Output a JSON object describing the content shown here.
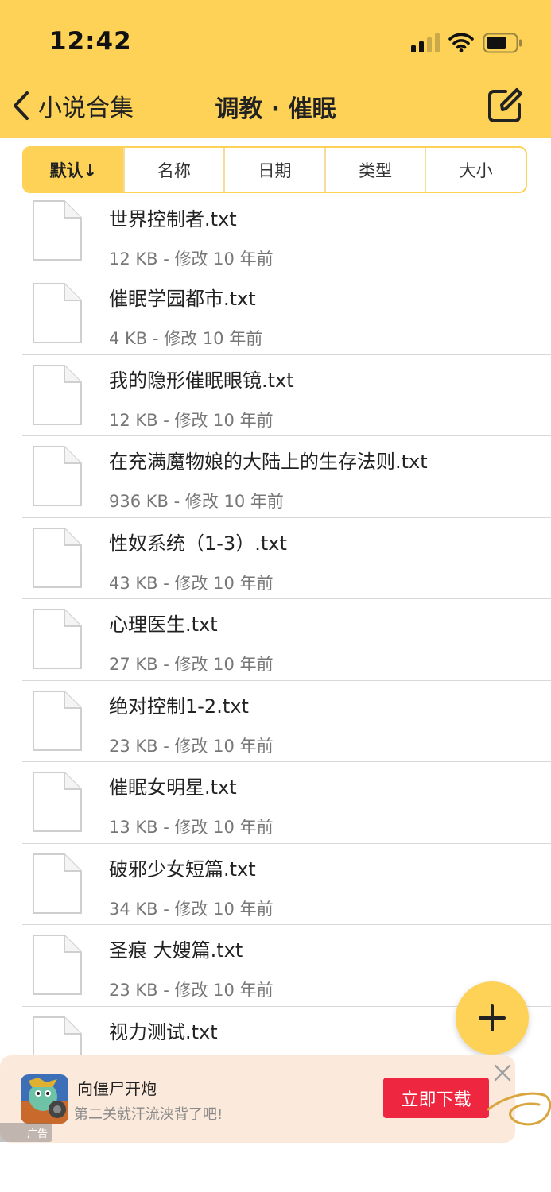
{
  "status_bar": {
    "time": "12:42"
  },
  "nav": {
    "back_label": "小说合集",
    "title": "调教 · 催眠"
  },
  "sort": {
    "options": [
      "默认↓",
      "名称",
      "日期",
      "类型",
      "大小"
    ],
    "active_index": 0
  },
  "files": [
    {
      "name": "世界控制者.txt",
      "meta": "12 KB - 修改 10 年前"
    },
    {
      "name": "催眠学园都市.txt",
      "meta": "4 KB - 修改 10 年前"
    },
    {
      "name": "我的隐形催眠眼镜.txt",
      "meta": "12 KB - 修改 10 年前"
    },
    {
      "name": "在充满魔物娘的大陆上的生存法则.txt",
      "meta": "936 KB - 修改 10 年前"
    },
    {
      "name": "性奴系统（1-3）.txt",
      "meta": "43 KB - 修改 10 年前"
    },
    {
      "name": "心理医生.txt",
      "meta": "27 KB - 修改 10 年前"
    },
    {
      "name": "绝对控制1-2.txt",
      "meta": "23 KB - 修改 10 年前"
    },
    {
      "name": "催眠女明星.txt",
      "meta": "13 KB - 修改 10 年前"
    },
    {
      "name": "破邪少女短篇.txt",
      "meta": "34 KB - 修改 10 年前"
    },
    {
      "name": "圣痕 大嫂篇.txt",
      "meta": "23 KB - 修改 10 年前"
    },
    {
      "name": "视力测试.txt",
      "meta": ""
    }
  ],
  "ad": {
    "title": "向僵尸开炮",
    "subtitle": "第二关就汗流浃背了吧!",
    "button_label": "立即下载",
    "tag": "广告"
  },
  "colors": {
    "accent": "#fdd257",
    "ad_button": "#ee2640",
    "ad_background": "#fbe9dc"
  },
  "icons": [
    "chevron-left-icon",
    "edit-icon",
    "file-icon",
    "plus-icon",
    "close-icon",
    "signal-icon",
    "wifi-icon",
    "battery-icon"
  ]
}
